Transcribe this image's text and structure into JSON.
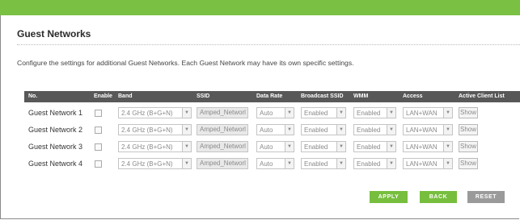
{
  "section": {
    "title": "Guest Networks",
    "description": "Configure the settings for additional Guest Networks. Each Guest Network may have its own specific settings."
  },
  "table": {
    "headers": {
      "no": "No.",
      "enable": "Enable",
      "band": "Band",
      "ssid": "SSID",
      "data_rate": "Data Rate",
      "broadcast_ssid": "Broadcast SSID",
      "wmm": "WMM",
      "access": "Access",
      "active_client_list": "Active Client List"
    },
    "rows": [
      {
        "name": "Guest Network 1",
        "enabled": false,
        "band": "2.4 GHz (B+G+N)",
        "ssid": "Amped_Networl",
        "data_rate": "Auto",
        "broadcast_ssid": "Enabled",
        "wmm": "Enabled",
        "access": "LAN+WAN",
        "client_list": "Show"
      },
      {
        "name": "Guest Network 2",
        "enabled": false,
        "band": "2.4 GHz (B+G+N)",
        "ssid": "Amped_Networl",
        "data_rate": "Auto",
        "broadcast_ssid": "Enabled",
        "wmm": "Enabled",
        "access": "LAN+WAN",
        "client_list": "Show"
      },
      {
        "name": "Guest Network 3",
        "enabled": false,
        "band": "2.4 GHz (B+G+N)",
        "ssid": "Amped_Networl",
        "data_rate": "Auto",
        "broadcast_ssid": "Enabled",
        "wmm": "Enabled",
        "access": "LAN+WAN",
        "client_list": "Show"
      },
      {
        "name": "Guest Network 4",
        "enabled": false,
        "band": "2.4 GHz (B+G+N)",
        "ssid": "Amped_Networl",
        "data_rate": "Auto",
        "broadcast_ssid": "Enabled",
        "wmm": "Enabled",
        "access": "LAN+WAN",
        "client_list": "Show"
      }
    ]
  },
  "buttons": {
    "apply": "APPLY",
    "back": "BACK",
    "reset": "RESET"
  },
  "icons": {
    "dropdown": "chevron-down-icon"
  },
  "colors": {
    "accent_green": "#78be3e",
    "header_gray": "#585858",
    "reset_gray": "#9a9a9a"
  }
}
